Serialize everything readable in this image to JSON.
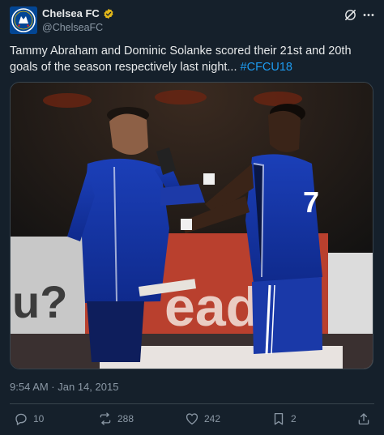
{
  "account": {
    "display_name": "Chelsea FC",
    "handle": "@ChelseaFC",
    "verified_icon": "verified-badge-icon",
    "avatar_icon": "chelsea-crest-icon"
  },
  "header_actions": {
    "grok_icon": "grok-icon",
    "more_icon": "more-icon"
  },
  "tweet": {
    "text": "Tammy Abraham and Dominic Solanke scored their 21st and 20th goals of the season respectively last night...",
    "hashtag": "#CFCU18"
  },
  "media": {
    "jersey_number": "7"
  },
  "timestamp": "9:54 AM · Jan 14, 2015",
  "actions": {
    "replies": "10",
    "reposts": "288",
    "likes": "242",
    "bookmarks": "2"
  },
  "colors": {
    "background": "#15202b",
    "accent": "#1d9bf0",
    "muted": "#8b98a5",
    "gold_badge": "#e2b719"
  }
}
